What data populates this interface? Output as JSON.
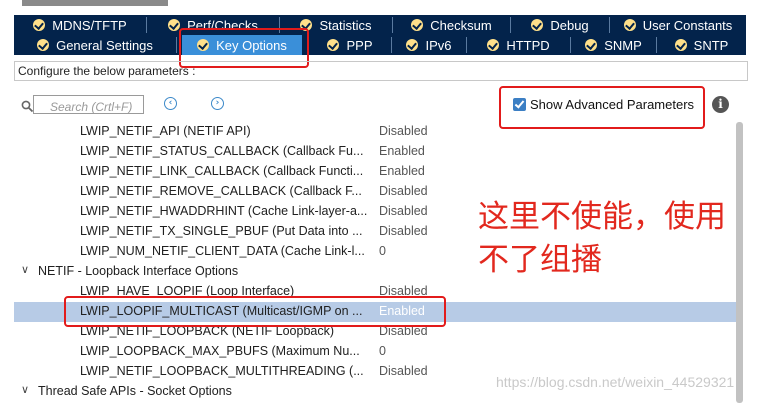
{
  "tabs_row1": [
    {
      "label": "MDNS/TFTP"
    },
    {
      "label": "Perf/Checks"
    },
    {
      "label": "Statistics"
    },
    {
      "label": "Checksum"
    },
    {
      "label": "Debug"
    },
    {
      "label": "User Constants"
    }
  ],
  "tabs_row2": [
    {
      "label": "General Settings"
    },
    {
      "label": "Key Options"
    },
    {
      "label": "PPP"
    },
    {
      "label": "IPv6"
    },
    {
      "label": "HTTPD"
    },
    {
      "label": "SNMP"
    },
    {
      "label": "SNTP"
    }
  ],
  "config_label": "Configure the below parameters :",
  "search": {
    "placeholder": "Search (Crtl+F)"
  },
  "show_advanced": {
    "label": "Show Advanced Parameters",
    "checked": true
  },
  "rows": [
    {
      "name": "LWIP_NETIF_API (NETIF API)",
      "value": "Disabled"
    },
    {
      "name": "LWIP_NETIF_STATUS_CALLBACK (Callback Fu...",
      "value": "Enabled"
    },
    {
      "name": "LWIP_NETIF_LINK_CALLBACK (Callback Functi...",
      "value": "Enabled"
    },
    {
      "name": "LWIP_NETIF_REMOVE_CALLBACK (Callback F...",
      "value": "Disabled"
    },
    {
      "name": "LWIP_NETIF_HWADDRHINT (Cache Link-layer-a...",
      "value": "Disabled"
    },
    {
      "name": "LWIP_NETIF_TX_SINGLE_PBUF (Put Data into ...",
      "value": "Disabled"
    },
    {
      "name": "LWIP_NUM_NETIF_CLIENT_DATA (Cache Link-l...",
      "value": "0"
    },
    {
      "name": "NETIF - Loopback Interface Options",
      "value": "",
      "group": true
    },
    {
      "name": "LWIP_HAVE_LOOPIF (Loop Interface)",
      "value": "Disabled"
    },
    {
      "name": "LWIP_LOOPIF_MULTICAST (Multicast/IGMP on ...",
      "value": "Enabled",
      "selected": true
    },
    {
      "name": "LWIP_NETIF_LOOPBACK (NETIF Loopback)",
      "value": "Disabled"
    },
    {
      "name": "LWIP_LOOPBACK_MAX_PBUFS (Maximum Nu...",
      "value": "0"
    },
    {
      "name": "LWIP_NETIF_LOOPBACK_MULTITHREADING (...",
      "value": "Disabled"
    },
    {
      "name": "Thread Safe APIs - Socket Options",
      "value": "",
      "group": true
    }
  ],
  "annotation": "这里不使能，使用不了组播",
  "watermark": "https://blog.csdn.net/weixin_44529321",
  "colors": {
    "tab_bg": "#03234b",
    "tab_active": "#3a8fd9",
    "highlight": "#e21b1b",
    "selected_row": "#b7cbe6"
  }
}
